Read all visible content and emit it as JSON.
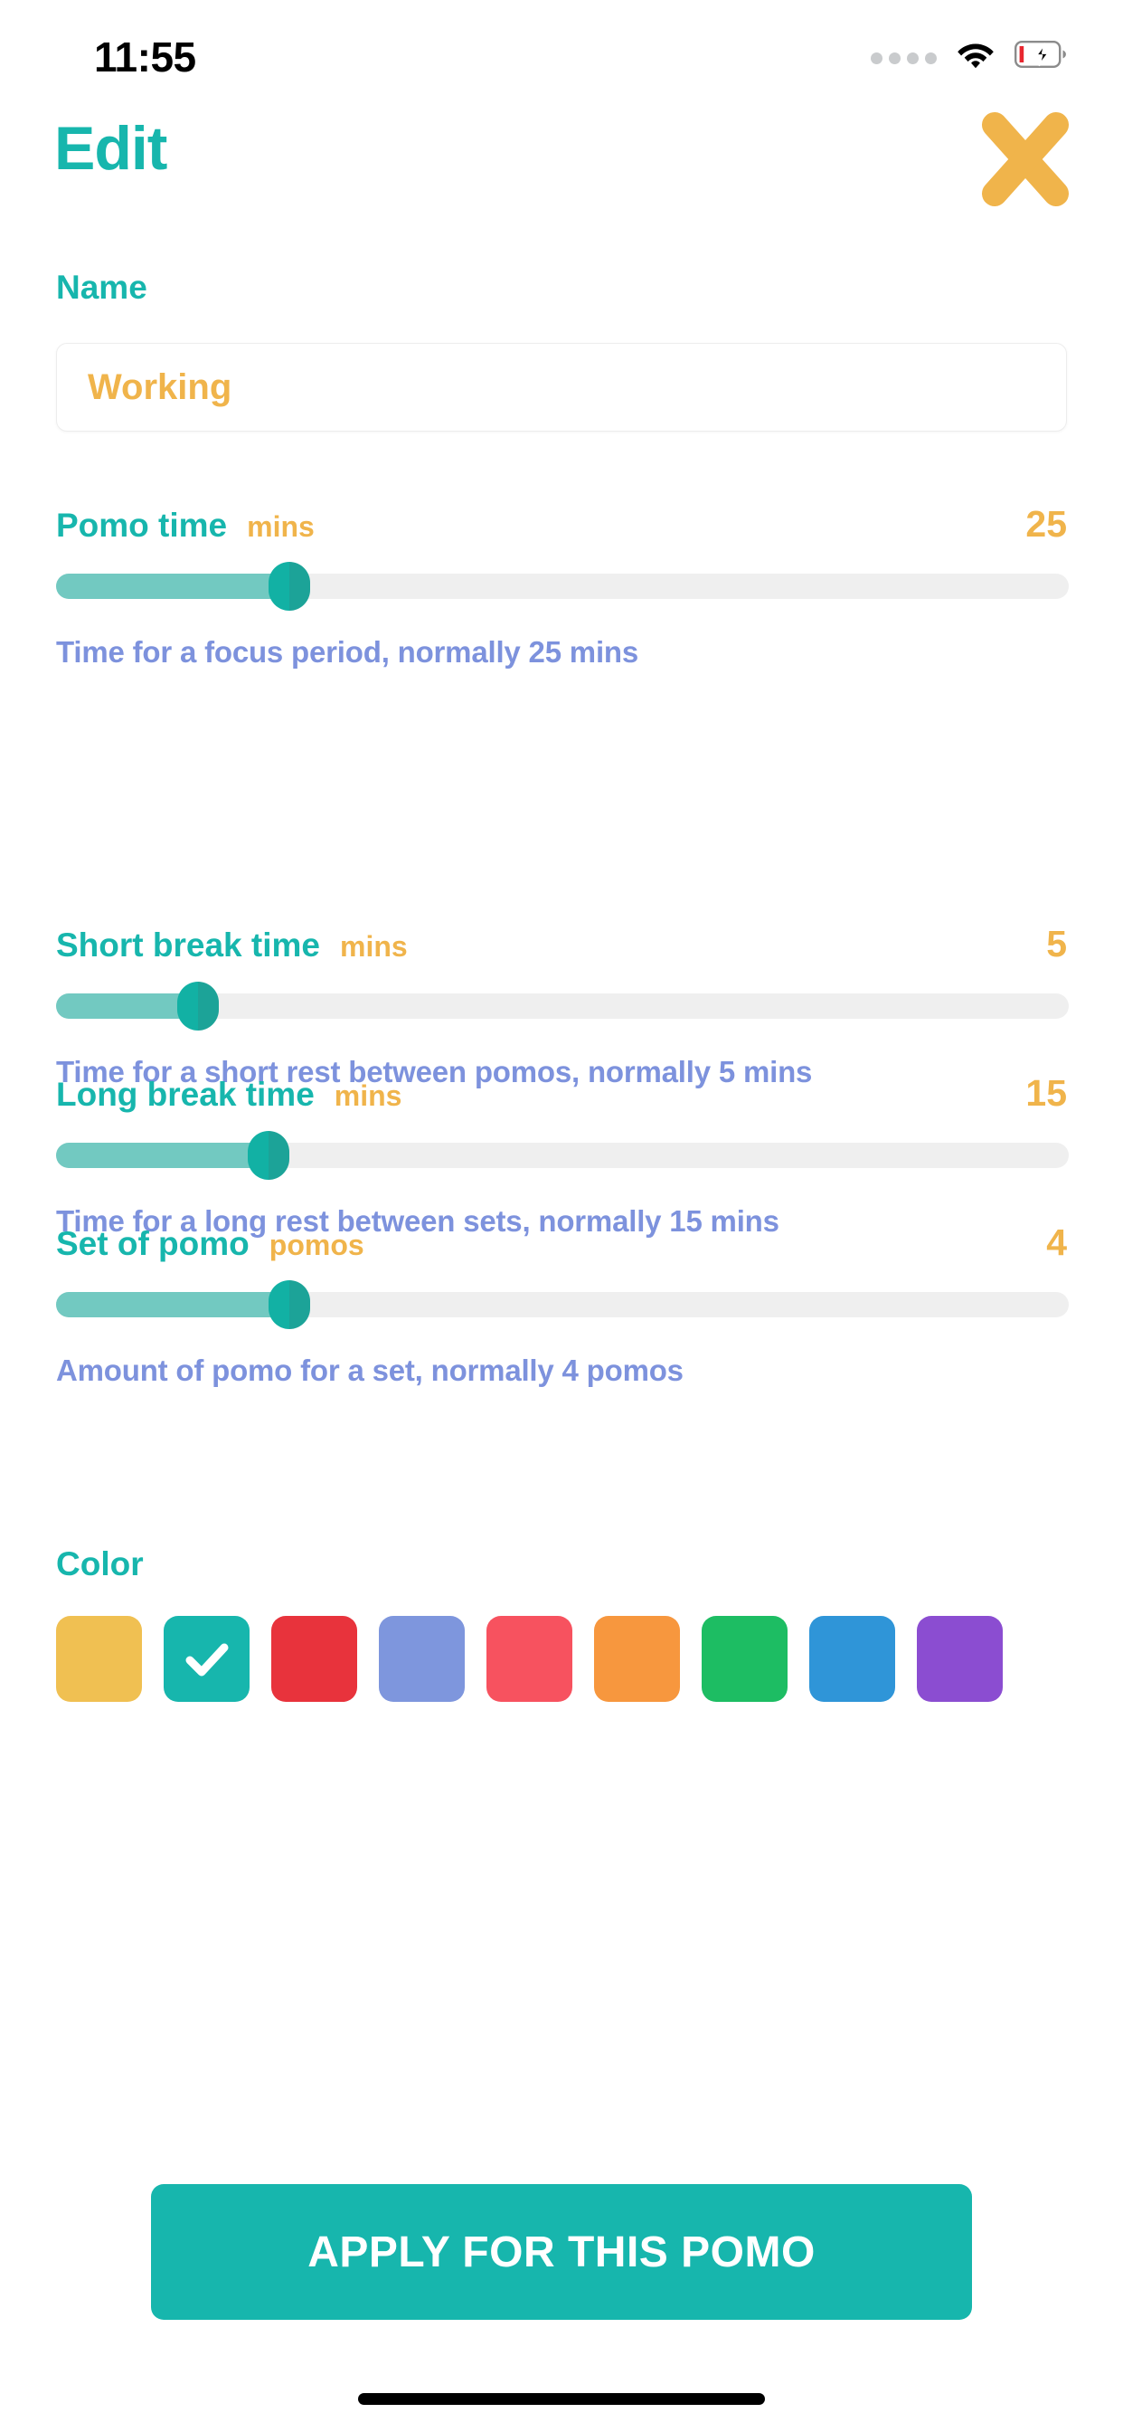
{
  "status_bar": {
    "time": "11:55",
    "signal_icon": "signal-dots-icon",
    "wifi_icon": "wifi-icon",
    "battery_icon": "battery-charging-low-icon"
  },
  "header": {
    "title": "Edit",
    "close_icon": "close-x-icon"
  },
  "name_section": {
    "label": "Name",
    "value": "Working",
    "placeholder": "Name"
  },
  "sliders": [
    {
      "label": "Pomo time",
      "unit": "mins",
      "value": "25",
      "description": "Time for a focus period, normally 25 mins",
      "fill_percent": 23
    },
    {
      "label": "Short break time",
      "unit": "mins",
      "value": "5",
      "description": "Time for a short rest between pomos, normally 5 mins",
      "fill_percent": 14
    },
    {
      "label": "Long break time",
      "unit": "mins",
      "value": "15",
      "description": "Time for a long rest between sets, normally 15 mins",
      "fill_percent": 21
    },
    {
      "label": "Set of pomo",
      "unit": "pomos",
      "value": "4",
      "description": "Amount of pomo for a set, normally 4 pomos",
      "fill_percent": 23
    }
  ],
  "color_section": {
    "label": "Color",
    "selected_index": 1,
    "check_icon": "check-icon",
    "swatches": [
      {
        "name": "yellow",
        "hex": "#f0c052"
      },
      {
        "name": "teal",
        "hex": "#17b6ad"
      },
      {
        "name": "red",
        "hex": "#e8333c"
      },
      {
        "name": "indigo",
        "hex": "#7e96dd"
      },
      {
        "name": "pink",
        "hex": "#f7525f"
      },
      {
        "name": "orange",
        "hex": "#f7973e"
      },
      {
        "name": "green",
        "hex": "#1dbd63"
      },
      {
        "name": "blue",
        "hex": "#2f95d8"
      },
      {
        "name": "purple",
        "hex": "#8b4dd1"
      }
    ]
  },
  "apply_button": {
    "label": "APPLY FOR THIS POMO",
    "color": "#17b6ad"
  },
  "theme": {
    "accent_teal": "#17b6ad",
    "accent_amber": "#f0b44b",
    "desc_blue": "#7d92dd",
    "track_grey": "#efefef",
    "fill_teal": "#72c9c1"
  }
}
